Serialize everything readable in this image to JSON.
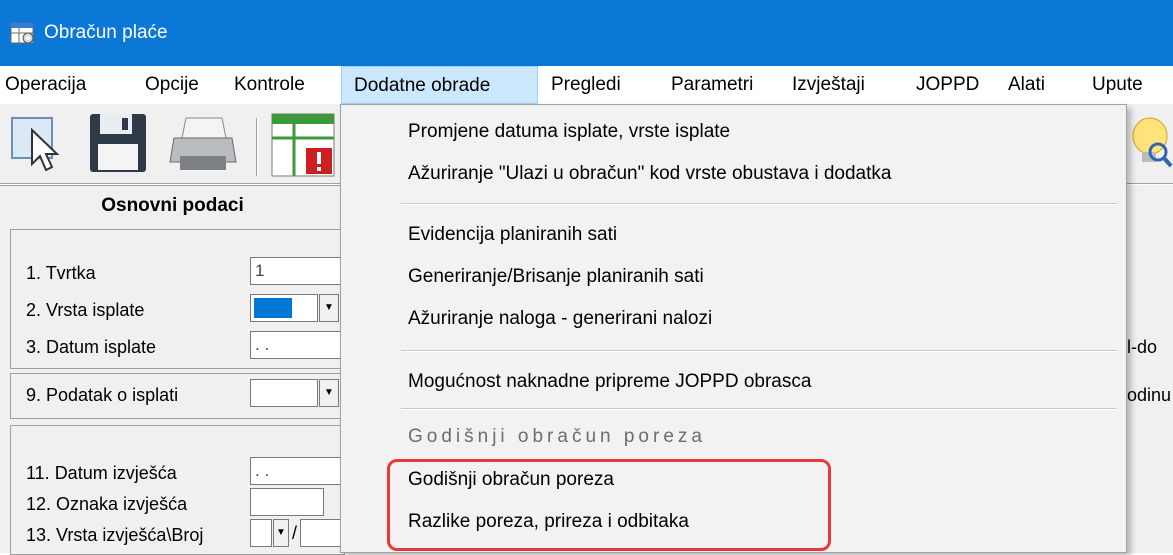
{
  "window": {
    "title": "Obračun plaće"
  },
  "menubar": {
    "items": [
      "Operacija",
      "Opcije",
      "Kontrole",
      "Dodatne obrade",
      "Pregledi",
      "Parametri",
      "Izvještaji",
      "JOPPD",
      "Alati",
      "Upute"
    ],
    "active": "Dodatne obrade"
  },
  "toolbar": {
    "icons": [
      "select-pointer-icon",
      "save-disk-icon",
      "printer-icon",
      "table-alert-icon",
      "lightbulb-search-icon"
    ]
  },
  "form": {
    "section_title": "Osnovni podaci",
    "fields": [
      {
        "label": "1. Tvrtka",
        "value": "1"
      },
      {
        "label": "2. Vrsta isplate",
        "value": ""
      },
      {
        "label": "3. Datum isplate",
        "value": ". ."
      },
      {
        "label": "9. Podatak o isplati",
        "value": ""
      },
      {
        "label": "11. Datum izvješća",
        "value": ". ."
      },
      {
        "label": "12. Oznaka izvješća",
        "value": ""
      },
      {
        "label": "13. Vrsta izvješća\\Broj",
        "value": "",
        "separator": "/"
      }
    ],
    "right_fragments": [
      "l-do",
      "odinu"
    ]
  },
  "dropdown": {
    "items": [
      {
        "label": "Promjene datuma isplate, vrste isplate"
      },
      {
        "label": "Ažuriranje \"Ulazi u obračun\" kod vrste obustava i dodatka"
      },
      {
        "label": "Evidencija planiranih sati"
      },
      {
        "label": "Generiranje/Brisanje planiranih sati"
      },
      {
        "label": "Ažuriranje naloga - generirani nalozi"
      },
      {
        "label": "Mogućnost naknadne pripreme JOPPD obrasca"
      },
      {
        "label": "Godišnji obračun poreza",
        "disabled": true
      },
      {
        "label": "Godišnji obračun poreza"
      },
      {
        "label": "Razlike poreza, prireza i odbitaka"
      }
    ]
  },
  "colors": {
    "titlebar": "#0b78d7",
    "menu_active_bg": "#cce8ff",
    "highlight_border": "#e8383b"
  }
}
